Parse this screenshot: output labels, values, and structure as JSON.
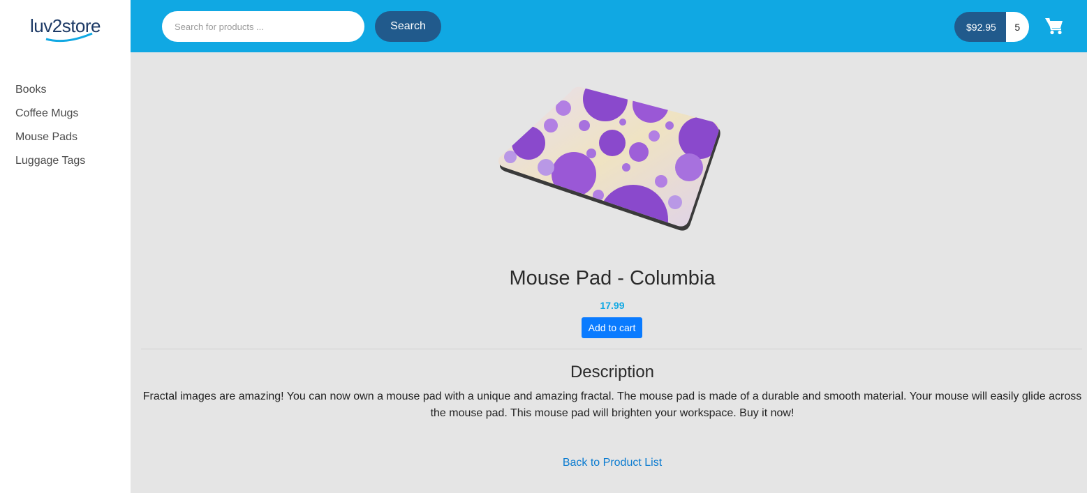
{
  "brand": {
    "logo_text": "luv2store"
  },
  "sidebar": {
    "items": [
      {
        "label": "Books"
      },
      {
        "label": "Coffee Mugs"
      },
      {
        "label": "Mouse Pads"
      },
      {
        "label": "Luggage Tags"
      }
    ]
  },
  "header": {
    "search": {
      "placeholder": "Search for products ..."
    },
    "search_button_label": "Search",
    "cart": {
      "total": "$92.95",
      "quantity": "5",
      "icon": "shopping-cart-icon"
    }
  },
  "product": {
    "name": "Mouse Pad - Columbia",
    "price": "17.99",
    "add_to_cart_label": "Add to cart",
    "description_heading": "Description",
    "description": "Fractal images are amazing! You can now own a mouse pad with a unique and amazing fractal. The mouse pad is made of a durable and smooth material. Your mouse will easily glide across the mouse pad. This mouse pad will brighten your workspace. Buy it now!",
    "back_link_label": "Back to Product List"
  },
  "colors": {
    "header_bg": "#10a8e3",
    "button_dark": "#215a8c",
    "primary_button": "#0a7bff",
    "price": "#10a8e3",
    "link": "#0a7bd0",
    "content_bg": "#e5e5e5"
  }
}
